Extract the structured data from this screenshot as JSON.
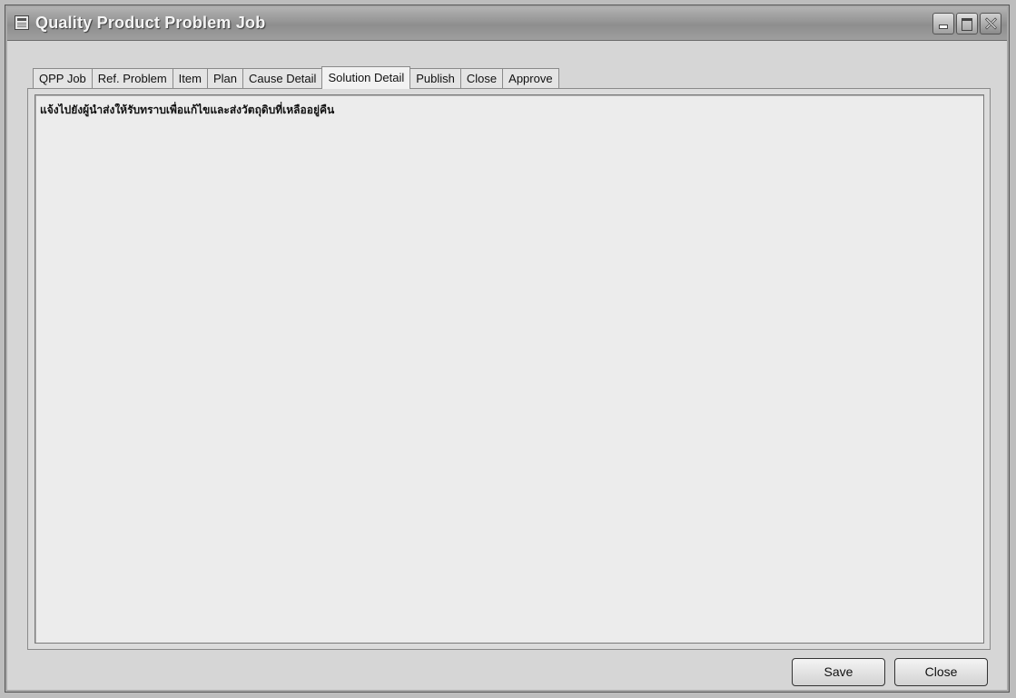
{
  "window": {
    "title": "Quality Product Problem Job"
  },
  "tabs": [
    {
      "label": "QPP Job",
      "active": false
    },
    {
      "label": "Ref. Problem",
      "active": false
    },
    {
      "label": "Item",
      "active": false
    },
    {
      "label": "Plan",
      "active": false
    },
    {
      "label": "Cause Detail",
      "active": false
    },
    {
      "label": "Solution Detail",
      "active": true
    },
    {
      "label": "Publish",
      "active": false
    },
    {
      "label": "Close",
      "active": false
    },
    {
      "label": "Approve",
      "active": false
    }
  ],
  "solution_detail": {
    "text": "แจ้งไปยังผู้นำส่งให้รับทราบเพื่อแก้ไขและส่งวัตถุดิบที่เหลืออยู่คืน"
  },
  "buttons": {
    "save_label": "Save",
    "close_label": "Close"
  }
}
